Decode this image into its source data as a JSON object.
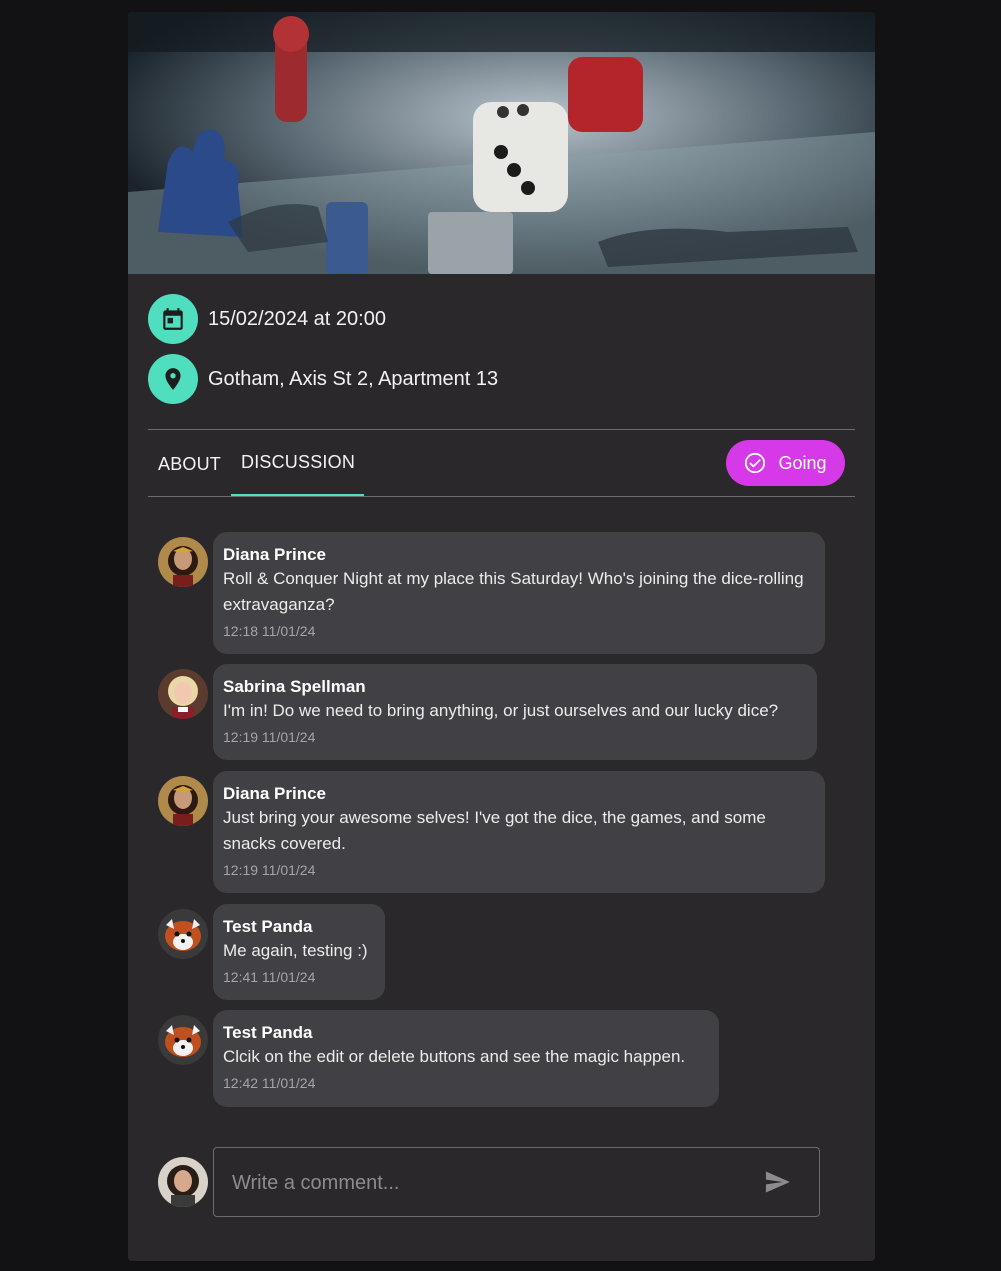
{
  "event": {
    "date_text": "15/02/2024 at 20:00",
    "location_text": "Gotham, Axis St 2, Apartment 13"
  },
  "tabs": [
    {
      "label": "ABOUT"
    },
    {
      "label": "DISCUSSION",
      "active": true
    }
  ],
  "rsvp": {
    "label": "Going"
  },
  "comments": [
    {
      "author": "Diana Prince",
      "text": "Roll & Conquer Night at my place this Saturday! Who's joining the dice-rolling extravaganza?",
      "time": "12:18 11/01/24"
    },
    {
      "author": "Sabrina Spellman",
      "text": "I'm in! Do we need to bring anything, or just ourselves and our lucky dice?",
      "time": "12:19 11/01/24"
    },
    {
      "author": "Diana Prince",
      "text": "Just bring your awesome selves! I've got the dice, the games, and some snacks covered.",
      "time": "12:19 11/01/24"
    },
    {
      "author": "Test Panda",
      "text": "Me again, testing :)",
      "time": "12:41 11/01/24"
    },
    {
      "author": "Test Panda",
      "text": "Clcik on the edit or delete buttons and see the magic happen.",
      "time": "12:42 11/01/24"
    }
  ],
  "composer": {
    "placeholder": "Write a comment..."
  },
  "colors": {
    "accent": "#4fdfbe",
    "going": "#d63ae8",
    "card": "#2a282b",
    "bubble": "#414045"
  },
  "icons": {
    "date": "calendar-icon",
    "location": "location-pin-icon",
    "going": "check-circle-icon",
    "send": "send-icon"
  }
}
